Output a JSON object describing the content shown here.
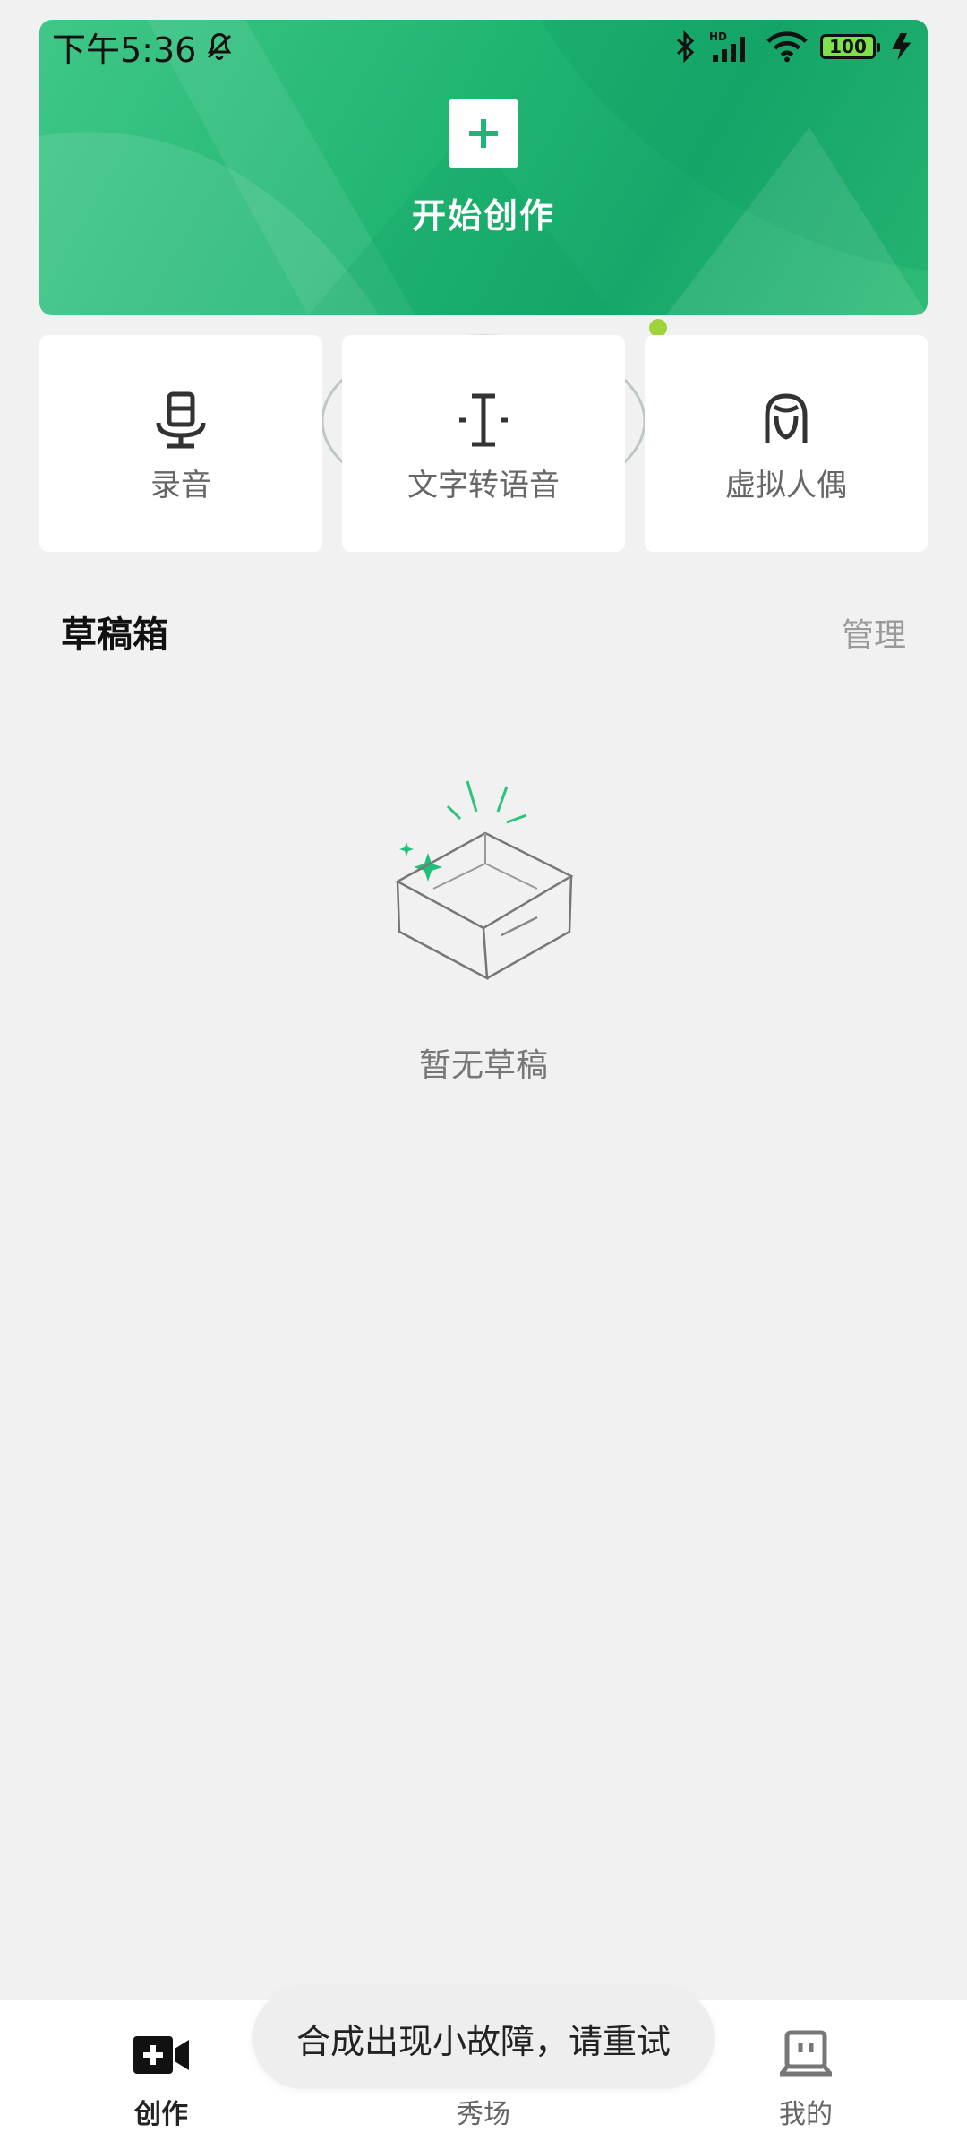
{
  "status_bar": {
    "time": "下午5:36",
    "battery": "100",
    "network_badge": "HD"
  },
  "hero": {
    "title": "开始创作",
    "icon": "plus-icon",
    "accent": "#21b572"
  },
  "tools": [
    {
      "label": "录音",
      "icon": "microphone-icon"
    },
    {
      "label": "文字转语音",
      "icon": "text-cursor-icon"
    },
    {
      "label": "虚拟人偶",
      "icon": "avatar-icon"
    }
  ],
  "drafts": {
    "title": "草稿箱",
    "manage_label": "管理",
    "empty_text": "暂无草稿"
  },
  "bottom_nav": {
    "items": [
      {
        "label": "创作",
        "icon": "video-plus-icon",
        "active": true
      },
      {
        "label": "秀场",
        "icon": "showroom-icon",
        "active": false
      },
      {
        "label": "我的",
        "icon": "profile-tv-icon",
        "active": false
      }
    ]
  },
  "toast": {
    "text": "合成出现小故障，请重试"
  }
}
